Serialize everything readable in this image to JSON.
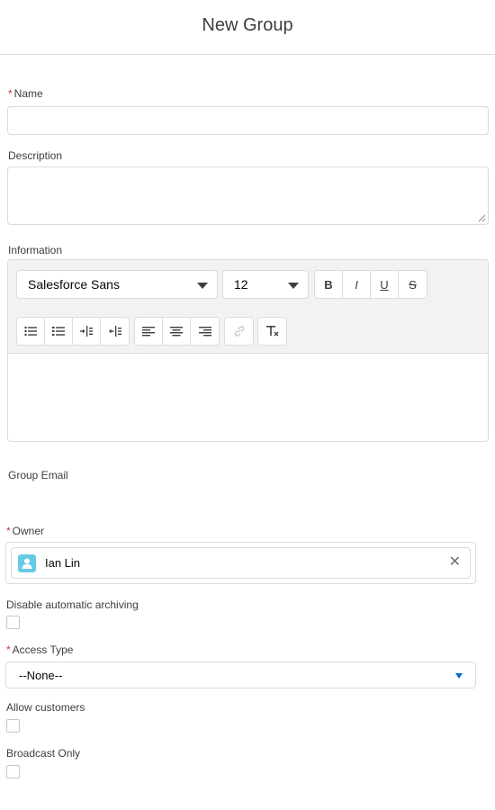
{
  "header": {
    "title": "New Group"
  },
  "form": {
    "name": {
      "label": "Name",
      "required_mark": "*",
      "value": ""
    },
    "description": {
      "label": "Description",
      "value": ""
    },
    "information": {
      "label": "Information",
      "font_family": "Salesforce Sans",
      "font_size": "12",
      "format_buttons": [
        "B",
        "I",
        "U",
        "S"
      ],
      "content": ""
    },
    "group_email": {
      "label": "Group Email"
    },
    "owner": {
      "label": "Owner",
      "required_mark": "*",
      "value": "Ian Lin",
      "clear_glyph": "✕"
    },
    "disable_archiving": {
      "label": "Disable automatic archiving",
      "checked": false
    },
    "access_type": {
      "label": "Access Type",
      "required_mark": "*",
      "value": "--None--"
    },
    "allow_customers": {
      "label": "Allow customers",
      "checked": false
    },
    "broadcast_only": {
      "label": "Broadcast Only",
      "checked": false
    }
  },
  "colors": {
    "required": "#c23934",
    "accent": "#0070d2",
    "avatar": "#65cae4",
    "border": "#dddbda"
  }
}
